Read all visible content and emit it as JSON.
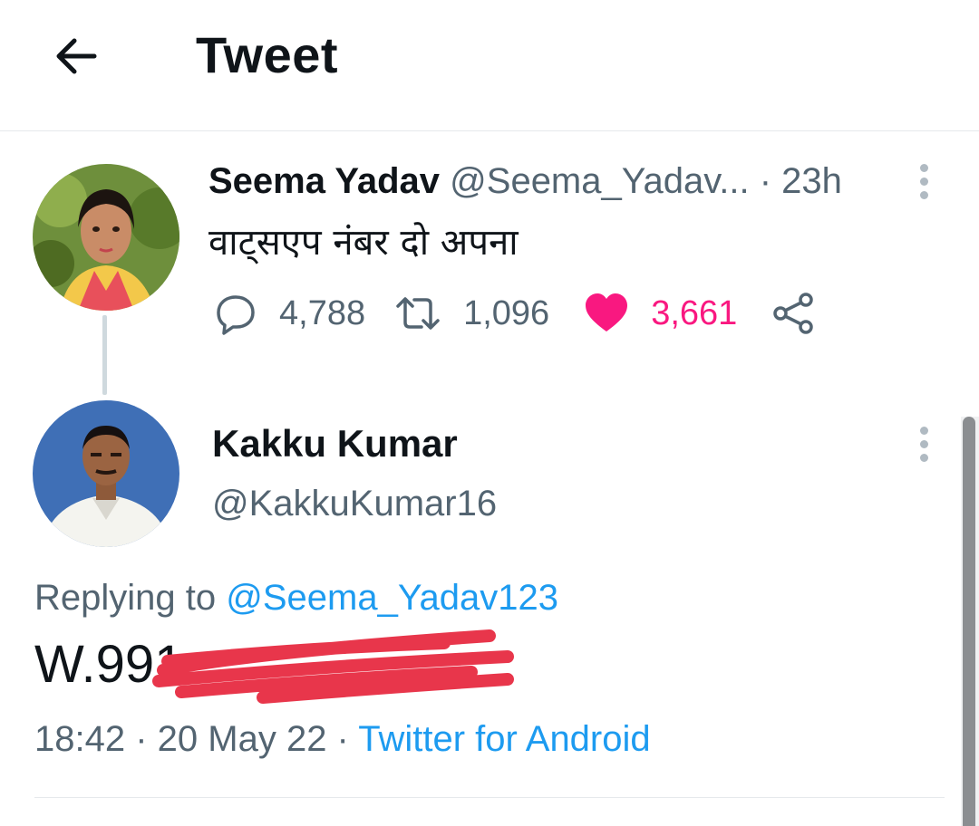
{
  "header": {
    "title": "Tweet",
    "back_icon": "arrow-left-icon"
  },
  "tweet": {
    "author_name": "Seema Yadav",
    "author_handle": "@Seema_Yadav...",
    "separator": " · ",
    "time": "23h",
    "text": "वाट्सएप नंबर दो अपना",
    "actions": {
      "replies": "4,788",
      "retweets": "1,096",
      "likes": "3,661",
      "liked": true
    },
    "colors": {
      "like": "#f91880",
      "muted": "#536471"
    }
  },
  "reply": {
    "author_name": "Kakku Kumar",
    "author_handle": "@KakkuKumar16",
    "replying_label": "Replying to ",
    "replying_handle": "@Seema_Yadav123",
    "text": "W.991",
    "redacted": true,
    "time": "18:42",
    "date": "20 May 22",
    "separator": " · ",
    "source": "Twitter for Android",
    "colors": {
      "link": "#1d9bf0",
      "redaction": "#e8364b"
    }
  }
}
